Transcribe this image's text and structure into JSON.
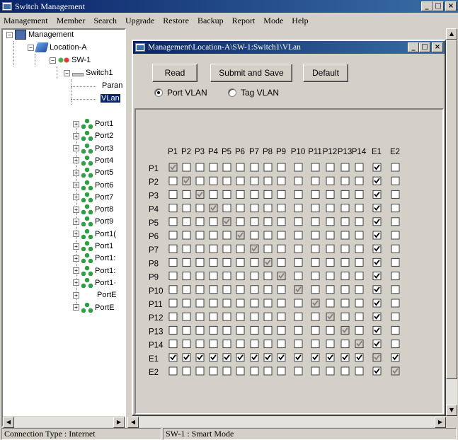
{
  "window": {
    "title": "Switch Management",
    "minimize": "_",
    "maximize": "□",
    "close": "×"
  },
  "menu": [
    "Management",
    "Member",
    "Search",
    "Upgrade",
    "Restore",
    "Backup",
    "Report",
    "Mode",
    "Help"
  ],
  "tree": {
    "root": "Management",
    "location": "Location-A",
    "sw": "SW-1",
    "switch": "Switch1",
    "param": "Paran",
    "vlan": "VLan",
    "ports": [
      "Port1",
      "Port2",
      "Port3",
      "Port4",
      "Port5",
      "Port6",
      "Port7",
      "Port8",
      "Port9",
      "Port1(",
      "Port1",
      "Port1:",
      "Port1:",
      "Port1·",
      "PortE",
      "PortE"
    ]
  },
  "child": {
    "title": "Management\\Location-A\\SW-1:Switch1\\VLan",
    "buttons": {
      "read": "Read",
      "submit": "Submit and Save",
      "default": "Default"
    },
    "radio": {
      "port_vlan": "Port VLAN",
      "tag_vlan": "Tag VLAN",
      "selected": "port_vlan"
    }
  },
  "vlan_matrix": {
    "columns": [
      "P1",
      "P2",
      "P3",
      "P4",
      "P5",
      "P6",
      "P7",
      "P8",
      "P9",
      "P10",
      "P11",
      "P12",
      "P13",
      "P14",
      "E1",
      "E2"
    ],
    "rows": [
      "P1",
      "P2",
      "P3",
      "P4",
      "P5",
      "P6",
      "P7",
      "P8",
      "P9",
      "P10",
      "P11",
      "P12",
      "P13",
      "P14",
      "E1",
      "E2"
    ],
    "checked_column": "E1",
    "checked_row": "E1",
    "diagonal_state": "checked-disabled"
  },
  "status": {
    "connection": "Connection Type : Internet",
    "mode": "SW-1 : Smart Mode"
  },
  "colors": {
    "titlebar_start": "#0a246a",
    "titlebar_end": "#3a6ea5",
    "face": "#d4d0c8"
  }
}
